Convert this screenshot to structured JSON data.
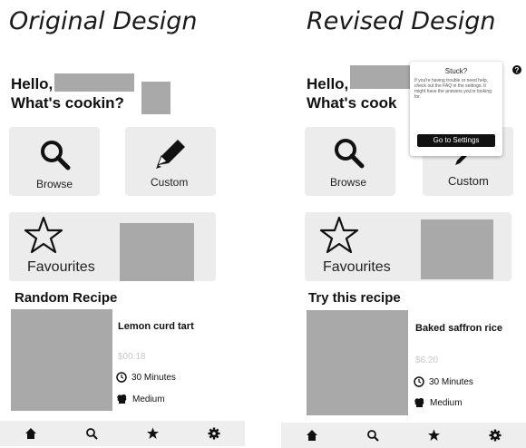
{
  "titles": {
    "original": "Original Design",
    "revised": "Revised Design"
  },
  "original": {
    "greeting_hello": "Hello,",
    "greeting_question": "What's cookin?",
    "browse_label": "Browse",
    "custom_label": "Custom",
    "favourites_label": "Favourites",
    "section_title": "Random Recipe",
    "recipe_name": "Lemon curd tart",
    "recipe_price": "$00.18",
    "time": "30 Minutes",
    "difficulty": "Medium"
  },
  "revised": {
    "greeting_hello": "Hello,",
    "greeting_question": "What's cook",
    "browse_label": "Browse",
    "custom_label": "Custom",
    "favourites_label": "Favourites",
    "section_title": "Try this recipe",
    "recipe_name": "Baked saffron rice",
    "recipe_price": "$6.20",
    "time": "30 Minutes",
    "difficulty": "Medium",
    "tooltip": {
      "title": "Stuck?",
      "body": "If you're having trouble or need help, check out the FAQ in the settings. It might have the answers you're looking for.",
      "button": "Go to Settings"
    },
    "help_icon": "?"
  },
  "icons": {
    "browse": "search-icon",
    "custom": "pencil-icon",
    "favourites": "star-icon",
    "time": "clock-icon",
    "difficulty": "chef-hat-icon",
    "tabs": [
      "home-icon",
      "search-icon",
      "star-icon",
      "gear-icon"
    ]
  },
  "colors": {
    "card": "#ececec",
    "redaction": "#a9a9a9",
    "tabbar": "#eeeeee",
    "button": "#111111"
  }
}
